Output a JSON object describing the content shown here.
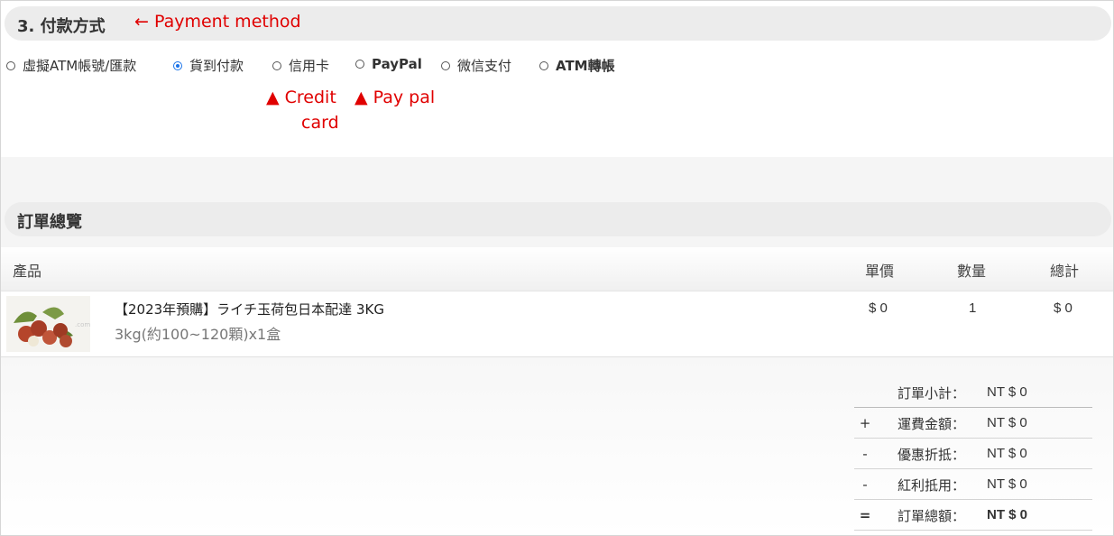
{
  "payment_section": {
    "title": "3. 付款方式",
    "annotation": "← Payment method",
    "options": [
      {
        "label": "虛擬ATM帳號/匯款",
        "selected": false
      },
      {
        "label": "貨到付款",
        "selected": true
      },
      {
        "label": "信用卡",
        "selected": false
      },
      {
        "label": "PayPal",
        "selected": false
      },
      {
        "label": "微信支付",
        "selected": false
      },
      {
        "label": "ATM轉帳",
        "selected": false
      }
    ],
    "credit_card_annotation": {
      "line1": "▲ Credit",
      "line2": "card"
    },
    "paypal_annotation": "▲ Pay pal"
  },
  "order_section": {
    "title": "訂單總覽",
    "columns": {
      "product": "產品",
      "unit_price": "單價",
      "quantity": "數量",
      "total": "總計"
    },
    "items": [
      {
        "name": "【2023年預購】ライチ玉荷包日本配達 3KG",
        "spec": "3kg(約100~120顆)x1盒",
        "unit_price": "$ 0",
        "quantity": "1",
        "total": "$ 0",
        "thumbnail_icon": "lychee-photo"
      }
    ],
    "summary": [
      {
        "op": "",
        "label": "訂單小計：",
        "value": "NT $ 0"
      },
      {
        "op": "+",
        "label": "運費金額：",
        "value": "NT $ 0"
      },
      {
        "op": "-",
        "label": "優惠折抵：",
        "value": "NT $ 0"
      },
      {
        "op": "-",
        "label": "紅利抵用：",
        "value": "NT $ 0"
      },
      {
        "op": "=",
        "label": "訂單總額：",
        "value": "NT $ 0"
      }
    ]
  },
  "colors": {
    "annotation": "#e00000",
    "radio_selected": "#1a73e8",
    "section_bar": "#ececec"
  }
}
